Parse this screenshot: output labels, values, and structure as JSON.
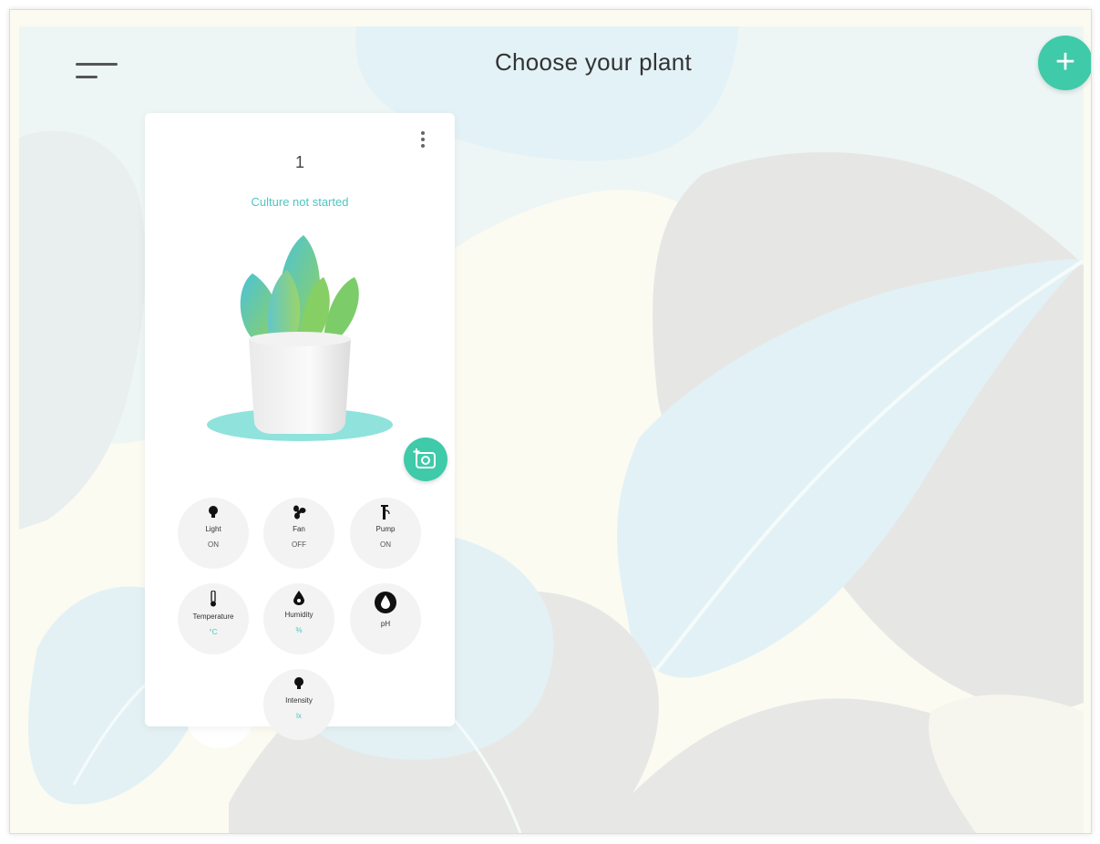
{
  "header": {
    "title": "Choose your plant",
    "menu_icon": "hamburger-menu-icon",
    "add_icon": "plus-icon",
    "add_symbol": "+"
  },
  "card": {
    "number": "1",
    "status": "Culture not started",
    "menu_icon": "kebab-menu-icon",
    "photo_icon": "add-photo-icon",
    "sensors": [
      {
        "icon": "lightbulb-icon",
        "label": "Light",
        "value": "ON"
      },
      {
        "icon": "fan-icon",
        "label": "Fan",
        "value": "OFF"
      },
      {
        "icon": "pump-icon",
        "label": "Pump",
        "value": "ON"
      },
      {
        "icon": "thermometer-icon",
        "label": "Temperature",
        "value": "°C"
      },
      {
        "icon": "drop-icon",
        "label": "Humidity",
        "value": "%"
      },
      {
        "icon": "ph-drop-icon",
        "label": "pH",
        "value": ""
      },
      {
        "icon": "lightbulb-icon",
        "label": "Intensity",
        "value": "lx"
      }
    ]
  },
  "colors": {
    "accent": "#3fcaa9",
    "status_text": "#4cc7c2",
    "leaf_light_blue": "#e3f3f6",
    "leaf_grey": "#e7e7e5",
    "cream": "#fbfbf0"
  }
}
